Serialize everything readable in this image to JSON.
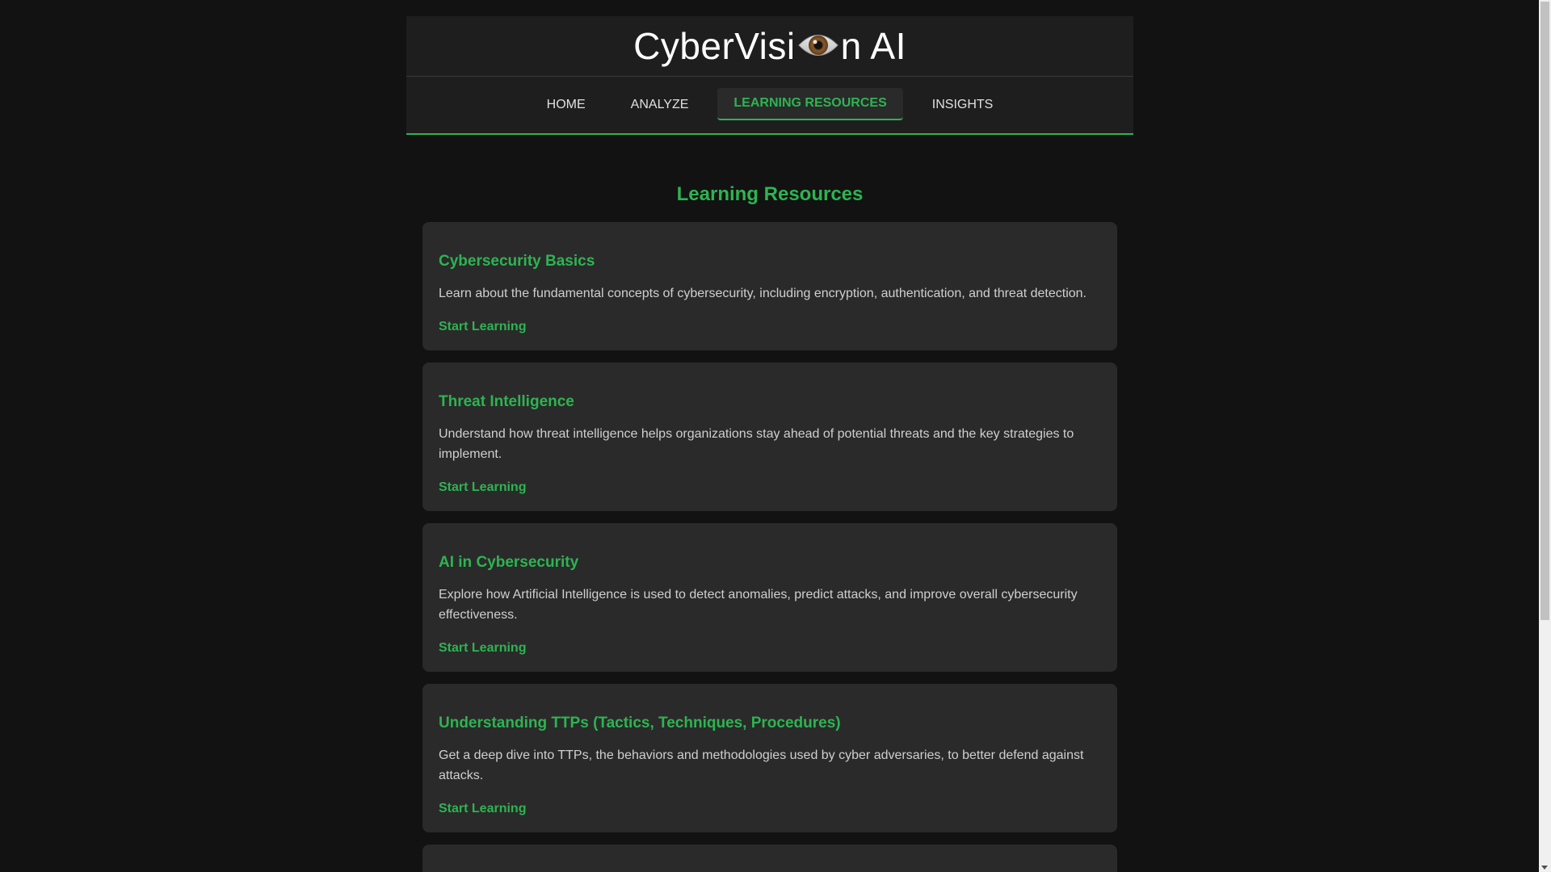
{
  "brand": {
    "title_prefix": "CyberVisi",
    "title_suffix": "n AI",
    "logo_icon": "eye-icon"
  },
  "nav": {
    "items": [
      {
        "label": "HOME"
      },
      {
        "label": "ANALYZE"
      },
      {
        "label": "LEARNING RESOURCES",
        "active": true
      },
      {
        "label": "INSIGHTS"
      }
    ]
  },
  "main": {
    "section_title": "Learning Resources",
    "cards": [
      {
        "title": "Cybersecurity Basics",
        "description": "Learn about the fundamental concepts of cybersecurity, including encryption, authentication, and threat detection.",
        "link": "Start Learning"
      },
      {
        "title": "Threat Intelligence",
        "description": "Understand how threat intelligence helps organizations stay ahead of potential threats and the key strategies to implement.",
        "link": "Start Learning"
      },
      {
        "title": "AI in Cybersecurity",
        "description": "Explore how Artificial Intelligence is used to detect anomalies, predict attacks, and improve overall cybersecurity effectiveness.",
        "link": "Start Learning"
      },
      {
        "title": "Understanding TTPs (Tactics, Techniques, Procedures)",
        "description": "Get a deep dive into TTPs, the behaviors and methodologies used by cyber adversaries, to better defend against attacks.",
        "link": "Start Learning"
      }
    ]
  },
  "colors": {
    "accent": "#2db451",
    "background": "#121212",
    "panel": "#1e1e1e",
    "card": "#2a2a2a"
  }
}
